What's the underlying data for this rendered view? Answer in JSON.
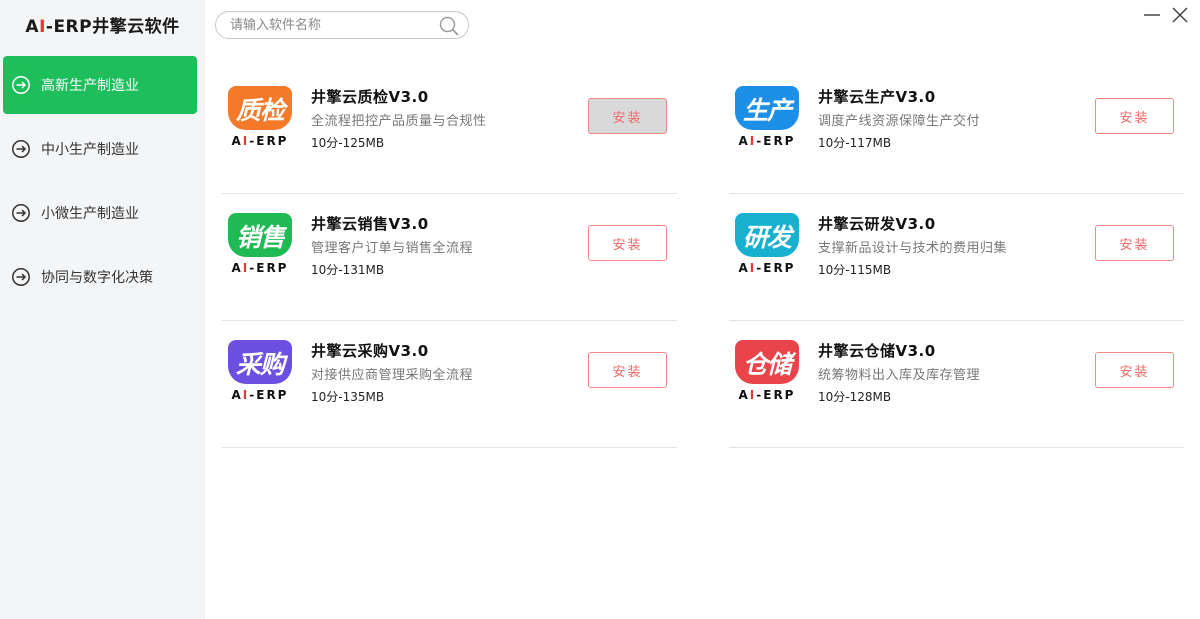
{
  "brand": {
    "prefix": "A",
    "i": "I",
    "suffix": "-ERP井擎云软件"
  },
  "search": {
    "placeholder": "请输入软件名称",
    "icon": "search-icon"
  },
  "window": {
    "minimize": "—",
    "close": "✕"
  },
  "sidebar": {
    "items": [
      {
        "label": "高新生产制造业",
        "active": true,
        "icon": "arrow-right-circle-icon"
      },
      {
        "label": "中小生产制造业",
        "active": false,
        "icon": "arrow-right-circle-icon"
      },
      {
        "label": "小微生产制造业",
        "active": false,
        "icon": "arrow-right-circle-icon"
      },
      {
        "label": "协同与数字化决策",
        "active": false,
        "icon": "arrow-right-circle-icon"
      }
    ]
  },
  "products": [
    {
      "logo_text": "质检",
      "logo_color": "#f47a2a",
      "tag_a": "A",
      "tag_i": "I",
      "tag_rest": "-ERP",
      "title": "井擎云质检V3.0",
      "desc": "全流程把控产品质量与合规性",
      "meta": "10分-125MB",
      "button": "安装",
      "pressed": true
    },
    {
      "logo_text": "生产",
      "logo_color": "#1d8fe6",
      "tag_a": "A",
      "tag_i": "I",
      "tag_rest": "-ERP",
      "title": "井擎云生产V3.0",
      "desc": "调度产线资源保障生产交付",
      "meta": "10分-117MB",
      "button": "安装",
      "pressed": false
    },
    {
      "logo_text": "销售",
      "logo_color": "#1fba54",
      "tag_a": "A",
      "tag_i": "I",
      "tag_rest": "-ERP",
      "title": "井擎云销售V3.0",
      "desc": "管理客户订单与销售全流程",
      "meta": "10分-131MB",
      "button": "安装",
      "pressed": false
    },
    {
      "logo_text": "研发",
      "logo_color": "#17b0cf",
      "tag_a": "A",
      "tag_i": "I",
      "tag_rest": "-ERP",
      "title": "井擎云研发V3.0",
      "desc": "支撑新品设计与技术的费用归集",
      "meta": "10分-115MB",
      "button": "安装",
      "pressed": false
    },
    {
      "logo_text": "采购",
      "logo_color": "#6a4fe0",
      "tag_a": "A",
      "tag_i": "I",
      "tag_rest": "-ERP",
      "title": "井擎云采购V3.0",
      "desc": "对接供应商管理采购全流程",
      "meta": "10分-135MB",
      "button": "安装",
      "pressed": false
    },
    {
      "logo_text": "仓储",
      "logo_color": "#e8444a",
      "tag_a": "A",
      "tag_i": "I",
      "tag_rest": "-ERP",
      "title": "井擎云仓储V3.0",
      "desc": "统筹物料出入库及库存管理",
      "meta": "10分-128MB",
      "button": "安装",
      "pressed": false
    }
  ]
}
